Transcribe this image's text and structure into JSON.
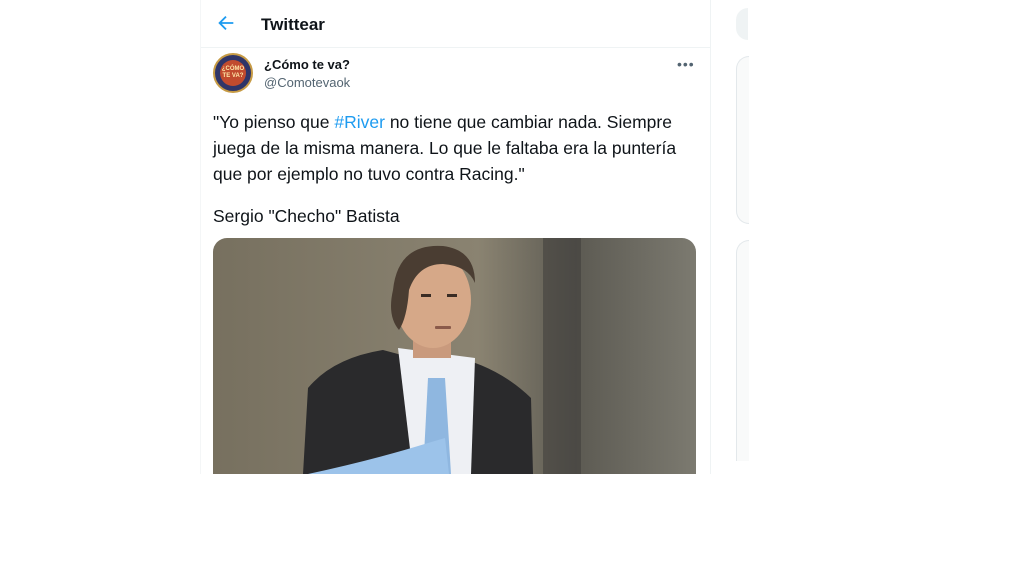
{
  "header": {
    "title": "Twittear",
    "back_icon": "arrow-left-icon"
  },
  "tweet": {
    "display_name": "¿Cómo te va?",
    "handle": "@Comotevaok",
    "avatar_text": "¿CÓMO TE VA?",
    "text_before": "\"Yo pienso que ",
    "hashtag": "#River",
    "text_after": " no tiene que cambiar nada. Siempre juega de la misma manera. Lo que le faltaba era la puntería que por ejemplo no tuvo contra Racing.\"",
    "author_line": "Sergio \"Checho\" Batista",
    "more_icon": "more-horizontal-icon"
  },
  "colors": {
    "accent": "#1d9bf0",
    "text": "#0f1419",
    "muted": "#536471"
  }
}
